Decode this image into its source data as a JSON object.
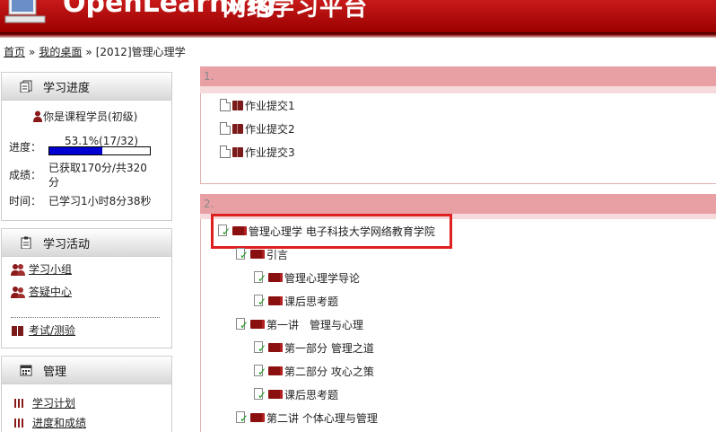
{
  "header": {
    "logo_text": "OpenLearning",
    "platform_name": "网络学习平台"
  },
  "breadcrumb": {
    "home": "首页",
    "separator": "»",
    "desktop": "我的桌面",
    "current": "[2012]管理心理学"
  },
  "progress_block": {
    "title": "学习进度",
    "user_role": "你是课程学员(初级)",
    "progress_label": "进度：",
    "progress_text": "53.1%(17/32)",
    "progress_fraction": 0.531,
    "score_label": "成绩：",
    "score_line1": "已获取170分/共320",
    "score_line2": "分",
    "time_label": "时间：",
    "time_value": "已学习1小时8分38秒"
  },
  "activity_block": {
    "title": "学习活动",
    "items": [
      "学习小组",
      "答疑中心",
      "考试/测验"
    ]
  },
  "manage_block": {
    "title": "管理",
    "items": [
      "学习计划",
      "进度和成绩"
    ]
  },
  "sections": [
    {
      "number": "1.",
      "items": [
        "作业提交1",
        "作业提交2",
        "作业提交3"
      ]
    },
    {
      "number": "2.",
      "course_title": "管理心理学 电子科技大学网络教育学院",
      "tree": [
        {
          "label": "引言",
          "level": 1
        },
        {
          "label": "管理心理学导论",
          "level": 2
        },
        {
          "label": "课后思考题",
          "level": 2
        },
        {
          "label": "第一讲　管理与心理",
          "level": 1
        },
        {
          "label": "第一部分 管理之道",
          "level": 2
        },
        {
          "label": "第二部分 攻心之策",
          "level": 2
        },
        {
          "label": "课后思考题",
          "level": 2
        },
        {
          "label": "第二讲 个体心理与管理",
          "level": 1
        }
      ]
    }
  ],
  "colors": {
    "header_red": "#b00000",
    "section_header": "#e8a0a4",
    "highlight_border": "#e02020",
    "progress_fill": "#0000d0"
  }
}
